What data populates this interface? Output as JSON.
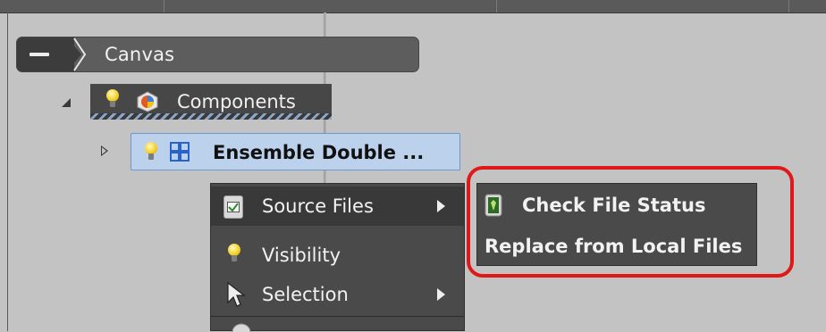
{
  "tree": {
    "canvas_label": "Canvas",
    "components_label": "Components",
    "ensemble_label": "Ensemble Double ..."
  },
  "context_menu": {
    "items": [
      {
        "label": "Source Files",
        "has_submenu": true,
        "icon": "source-files-icon"
      },
      {
        "label": "Visibility",
        "has_submenu": false,
        "icon": "bulb-icon"
      },
      {
        "label": "Selection",
        "has_submenu": true,
        "icon": "cursor-icon"
      }
    ]
  },
  "submenu": {
    "items": [
      {
        "label": "Check File Status",
        "icon": "file-status-icon"
      },
      {
        "label": "Replace from Local Files"
      }
    ]
  },
  "colors": {
    "highlight_box": "#e01818",
    "menu_bg": "#4a4a4a",
    "selection_bg": "#bcd2ec"
  }
}
